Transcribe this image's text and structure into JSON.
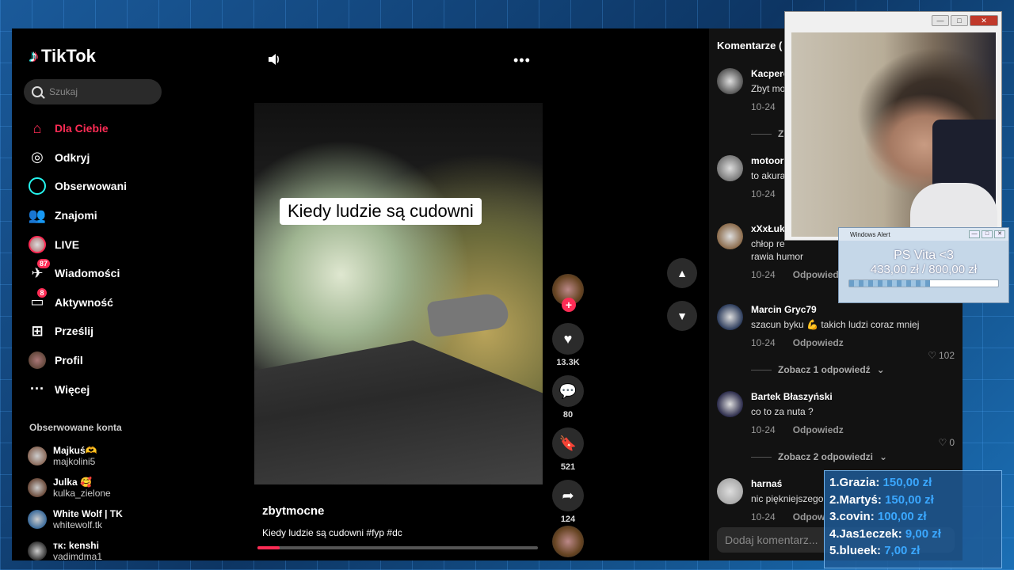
{
  "app": {
    "brand": "TikTok"
  },
  "search": {
    "placeholder": "Szukaj"
  },
  "nav": [
    {
      "label": "Dla Ciebie",
      "icon": "home-icon",
      "active": true
    },
    {
      "label": "Odkryj",
      "icon": "compass-icon"
    },
    {
      "label": "Obserwowani",
      "icon": "following-icon"
    },
    {
      "label": "Znajomi",
      "icon": "friends-icon"
    },
    {
      "label": "LIVE",
      "icon": "live-icon"
    },
    {
      "label": "Wiadomości",
      "icon": "messages-icon",
      "badge": "87"
    },
    {
      "label": "Aktywność",
      "icon": "activity-icon",
      "badge": "8"
    },
    {
      "label": "Prześlij",
      "icon": "upload-icon"
    },
    {
      "label": "Profil",
      "icon": "profile-icon"
    },
    {
      "label": "Więcej",
      "icon": "more-icon"
    }
  ],
  "followed": {
    "title": "Obserwowane konta",
    "accounts": [
      {
        "name": "Majkuś🫶",
        "user": "majkolini5",
        "color": "#8a6a5a"
      },
      {
        "name": "Julka 🥰",
        "user": "kulka_zielone",
        "color": "#6a4a3a"
      },
      {
        "name": "White Wolf | TK",
        "user": "whitewolf.tk",
        "color": "#3a6a9a"
      },
      {
        "name": "ᴛᴋ: kenshi",
        "user": "vadimdma1",
        "color": "#333333"
      }
    ]
  },
  "video": {
    "caption": "Kiedy ludzie są cudowni",
    "author": "zbytmocne",
    "description": "Kiedy ludzie są cudowni #fyp #dc",
    "progress": 0.08
  },
  "actions": {
    "likes": "13.3K",
    "comments": "80",
    "saves": "521",
    "shares": "124"
  },
  "comments": {
    "header": "Komentarze (",
    "input_placeholder": "Dodaj komentarz...",
    "items": [
      {
        "user": "Kacperc",
        "text": "Zbyt mo",
        "date": "10-24",
        "reply": "",
        "likes": "",
        "color": "#555555",
        "more": "Z"
      },
      {
        "user": "motoor",
        "text": "to akura",
        "date": "10-24",
        "reply": "",
        "likes": "",
        "color": "#777777",
        "more": ""
      },
      {
        "user": "xXxŁuk",
        "text": "chłop re\nrawia humor",
        "date": "10-24",
        "reply": "Odpowiedz",
        "likes": "",
        "color": "#8a6a4a",
        "more": ""
      },
      {
        "user": "Marcin Gryc79",
        "text": "szacun byku 💪 takich ludzi coraz mniej",
        "date": "10-24",
        "reply": "Odpowiedz",
        "likes": "102",
        "color": "#2a3a5a",
        "more": "Zobacz 1 odpowiedź"
      },
      {
        "user": "Bartek Błaszyński",
        "text": "co to za nuta ?",
        "date": "10-24",
        "reply": "Odpowiedz",
        "likes": "0",
        "color": "#2a2a4a",
        "more": "Zobacz 2 odpowiedzi"
      },
      {
        "user": "harnaś",
        "text": "nic piękniejszego",
        "date": "10-24",
        "reply": "Odpow",
        "likes": "",
        "color": "#aaaaaa",
        "more": ""
      }
    ]
  },
  "webcam": {
    "buttons": [
      "—",
      "□",
      "✕"
    ]
  },
  "alert": {
    "title": "Windows Alert",
    "goal_name": "PS Vita <3",
    "goal_amount": "433,00 zł / 800,00 zł",
    "goal_progress": 0.54
  },
  "donors": [
    {
      "rank": "1.",
      "name": "Grazia:",
      "amount": "150,00 zł"
    },
    {
      "rank": "2.",
      "name": "Martyś:",
      "amount": "150,00 zł"
    },
    {
      "rank": "3.",
      "name": "covin:",
      "amount": "100,00 zł"
    },
    {
      "rank": "4.",
      "name": "Jas1eczek:",
      "amount": "9,00 zł"
    },
    {
      "rank": "5.",
      "name": "blueek:",
      "amount": "7,00 zł"
    }
  ],
  "colors": {
    "accent": "#fe2c55",
    "cyan": "#25f4ee",
    "donor_amount": "#3aa7ff"
  }
}
